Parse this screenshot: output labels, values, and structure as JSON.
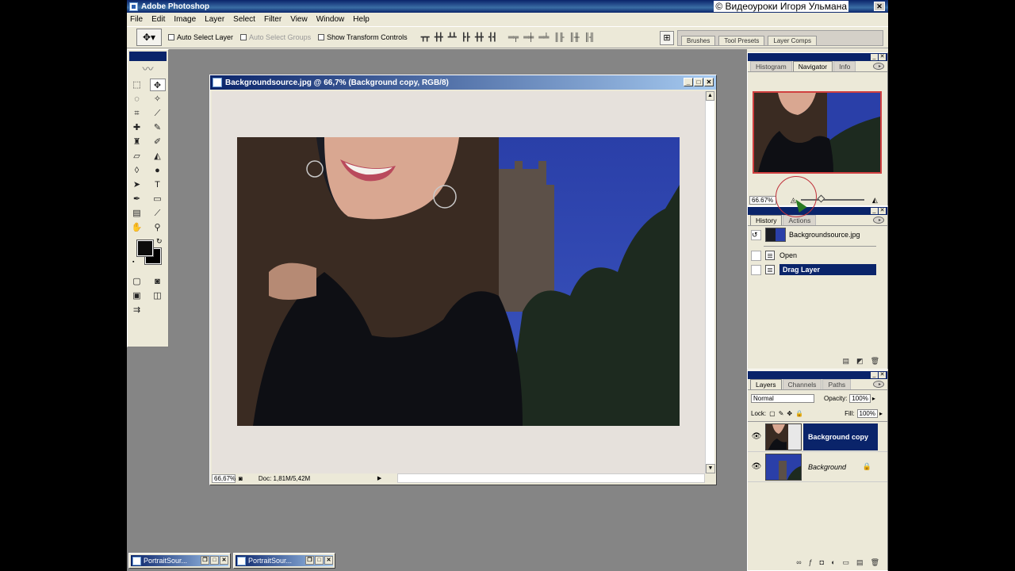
{
  "app": {
    "title": "Adobe Photoshop",
    "watermark": "© Видеоуроки Игоря Ульмана"
  },
  "menu": [
    "File",
    "Edit",
    "Image",
    "Layer",
    "Select",
    "Filter",
    "View",
    "Window",
    "Help"
  ],
  "options": {
    "auto_select_layer": "Auto Select Layer",
    "auto_select_groups": "Auto Select Groups",
    "show_transform_controls": "Show Transform Controls"
  },
  "palette_well": [
    "Brushes",
    "Tool Presets",
    "Layer Comps"
  ],
  "document": {
    "title": "Backgroundsource.jpg @ 66,7% (Background copy, RGB/8)",
    "zoom": "66,67%",
    "doc_size": "Doc: 1,81M/5,42M"
  },
  "minimized": [
    {
      "label": "PortraitSour..."
    },
    {
      "label": "PortraitSour..."
    }
  ],
  "navigator": {
    "tabs": [
      "Histogram",
      "Navigator",
      "Info"
    ],
    "zoom": "66.67%"
  },
  "history": {
    "tabs": [
      "History",
      "Actions"
    ],
    "snapshot": "Backgroundsource.jpg",
    "items": [
      "Open",
      "Drag Layer"
    ]
  },
  "layers": {
    "tabs": [
      "Layers",
      "Channels",
      "Paths"
    ],
    "blend_mode": "Normal",
    "opacity_label": "Opacity:",
    "opacity": "100%",
    "lock_label": "Lock:",
    "fill_label": "Fill:",
    "fill": "100%",
    "items": [
      "Background copy",
      "Background"
    ]
  },
  "colors": {
    "title_blue": "#0a246a",
    "panel_bg": "#ece9d8",
    "canvas_gray": "#858585",
    "nav_frame": "#d04040"
  }
}
